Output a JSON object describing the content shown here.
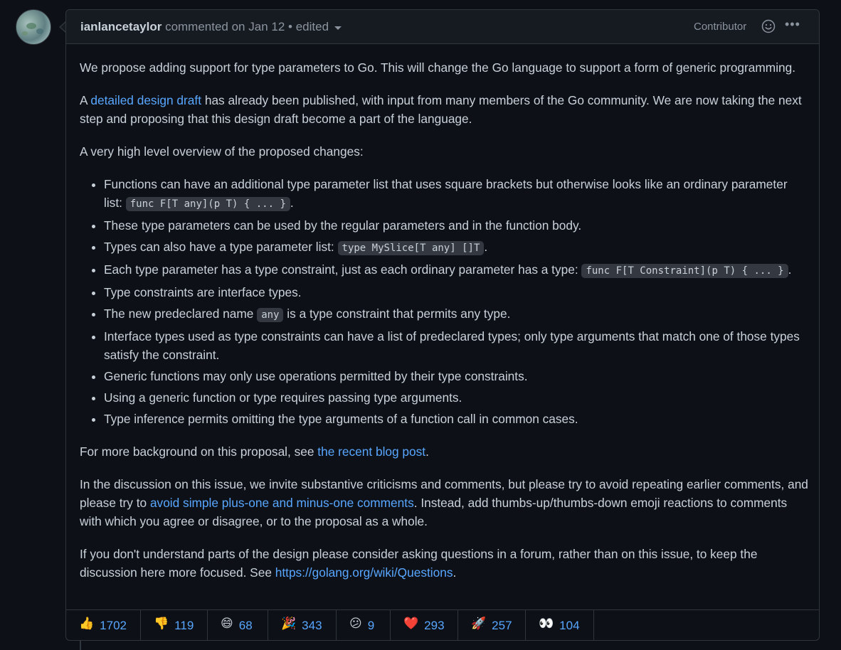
{
  "header": {
    "author": "ianlancetaylor",
    "action": "commented on Jan 12",
    "separator": "•",
    "edited": "edited",
    "role": "Contributor",
    "more": "•••"
  },
  "body": {
    "p1": "We propose adding support for type parameters to Go. This will change the Go language to support a form of generic programming.",
    "p2_pre": "A ",
    "p2_link": "detailed design draft",
    "p2_post": " has already been published, with input from many members of the Go community. We are now taking the next step and proposing that this design draft become a part of the language.",
    "p3": "A very high level overview of the proposed changes:",
    "list": {
      "i1_text": "Functions can have an additional type parameter list that uses square brackets but otherwise looks like an ordinary parameter list: ",
      "i1_code": "func F[T any](p T) { ... }",
      "i1_end": ".",
      "i2_text": "These type parameters can be used by the regular parameters and in the function body.",
      "i3_text": "Types can also have a type parameter list: ",
      "i3_code": "type MySlice[T any] []T",
      "i3_end": ".",
      "i4_text": "Each type parameter has a type constraint, just as each ordinary parameter has a type: ",
      "i4_code": "func F[T Constraint](p T) { ... }",
      "i4_end": ".",
      "i5_text": "Type constraints are interface types.",
      "i6_pre": "The new predeclared name ",
      "i6_code": "any",
      "i6_post": " is a type constraint that permits any type.",
      "i7_text": "Interface types used as type constraints can have a list of predeclared types; only type arguments that match one of those types satisfy the constraint.",
      "i8_text": "Generic functions may only use operations permitted by their type constraints.",
      "i9_text": "Using a generic function or type requires passing type arguments.",
      "i10_text": "Type inference permits omitting the type arguments of a function call in common cases."
    },
    "p4_pre": "For more background on this proposal, see ",
    "p4_link": "the recent blog post",
    "p4_post": ".",
    "p5_pre": "In the discussion on this issue, we invite substantive criticisms and comments, but please try to avoid repeating earlier comments, and please try to ",
    "p5_link": "avoid simple plus-one and minus-one comments",
    "p5_post": ". Instead, add thumbs-up/thumbs-down emoji reactions to comments with which you agree or disagree, or to the proposal as a whole.",
    "p6_pre": "If you don't understand parts of the design please consider asking questions in a forum, rather than on this issue, to keep the discussion here more focused. See ",
    "p6_link": "https://golang.org/wiki/Questions",
    "p6_post": "."
  },
  "reactions": [
    {
      "emoji": "👍",
      "count": "1702",
      "icon": "thumbs-up-icon"
    },
    {
      "emoji": "👎",
      "count": "119",
      "icon": "thumbs-down-icon"
    },
    {
      "emoji": "😄",
      "count": "68",
      "icon": "laugh-icon"
    },
    {
      "emoji": "🎉",
      "count": "343",
      "icon": "hooray-icon"
    },
    {
      "emoji": "😕",
      "count": "9",
      "icon": "confused-icon"
    },
    {
      "emoji": "❤️",
      "count": "293",
      "icon": "heart-icon"
    },
    {
      "emoji": "🚀",
      "count": "257",
      "icon": "rocket-icon"
    },
    {
      "emoji": "👀",
      "count": "104",
      "icon": "eyes-icon"
    }
  ],
  "colors": {
    "background": "#0d1117",
    "header_bg": "#161b22",
    "border": "#30363d",
    "text": "#c9d1d9",
    "muted": "#8b949e",
    "link": "#58a6ff",
    "code_bg": "#343941"
  }
}
